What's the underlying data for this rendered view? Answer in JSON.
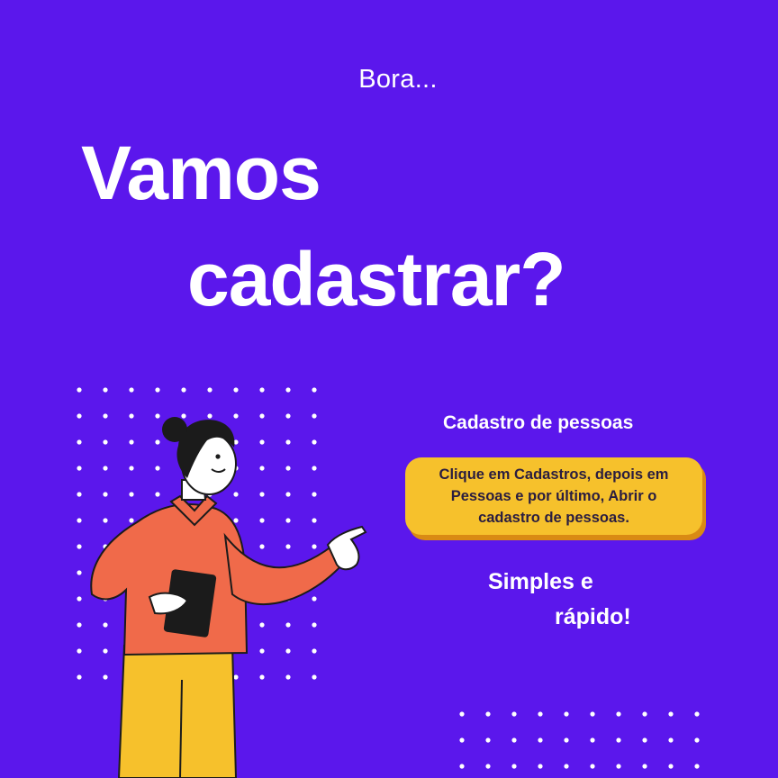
{
  "header": {
    "subtitle": "Bora...",
    "title_line1": "Vamos",
    "title_line2": "cadastrar?"
  },
  "info": {
    "heading": "Cadastro de pessoas",
    "instruction_line1": "Clique em Cadastros,  depois em",
    "instruction_line2": "Pessoas e por último,  Abrir o",
    "instruction_line3": "cadastro de pessoas."
  },
  "tagline": {
    "line1": "Simples e",
    "line2": "rápido!"
  },
  "colors": {
    "background": "#5b17ec",
    "card": "#f6c12c",
    "card_shadow": "#d98a14",
    "shirt": "#f06a4a",
    "pants": "#f6c12c",
    "text": "#ffffff"
  },
  "icons": [
    "dot-grid-decoration",
    "person-pointing-illustration"
  ]
}
